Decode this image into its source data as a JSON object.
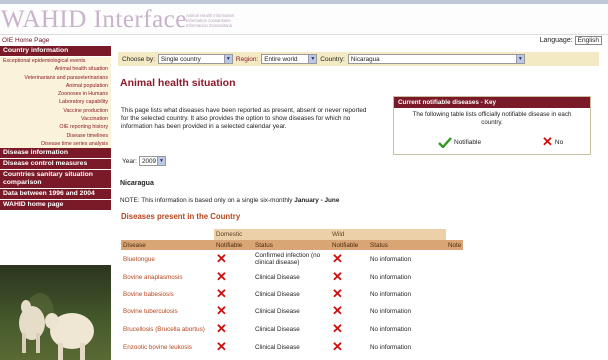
{
  "header": {
    "logo_text": "WAHID Interface",
    "logo_sub_lines": [
      "Animal Health Information",
      "Information zoosanitaire",
      "Información Zoosanitaria"
    ],
    "home_link": "OIE Home Page",
    "language_label": "Language:",
    "language_value": "English"
  },
  "sidebar": {
    "country_info_header": "Country information",
    "country_items": [
      "Exceptional epidemiological events",
      "Animal health situation",
      "Veterinarians and paraveterinarians",
      "Animal population",
      "Zoonoses in Humans",
      "Laboratory capability",
      "Vaccine production",
      "Vaccination",
      "OIE reporting history",
      "Disease timelines",
      "Disease time series analysis"
    ],
    "headers": [
      "Disease information",
      "Disease control measures",
      "Countries sanitary situation comparison",
      "Data between 1996 and 2004",
      "WAHID home page"
    ]
  },
  "filter": {
    "choose_by_label": "Choose by:",
    "choose_by_value": "Single country",
    "region_label": "Region:",
    "region_value": "Entire world",
    "country_label": "Country:",
    "country_value": "Nicaragua"
  },
  "main": {
    "title": "Animal health situation",
    "intro": "This page lists what diseases have been reported as present, absent or never reported for the selected country. It also provides the option to show diseases for which no information has been provided in a selected calendar year.",
    "year_label": "Year:",
    "year_value": "2009",
    "country_name": "Nicaragua",
    "note_prefix": "NOTE: This information is based only on a single six-monthly ",
    "note_period": "January - June",
    "section_title": "Diseases present in the Country"
  },
  "key": {
    "header": "Current notifiable diseases - Key",
    "text": "The following table lists officially notifiable disease in each country.",
    "notifiable_label": "Notifiable",
    "no_label": "No"
  },
  "table": {
    "group_domestic": "Domestic",
    "group_wild": "Wild",
    "columns": [
      "Disease",
      "Notifiable",
      "Status",
      "Notifiable",
      "Status",
      "Note"
    ],
    "rows": [
      {
        "disease": "Bluetongue",
        "dom_status": "Confirmed infection (no clinical disease)",
        "wild_status": "No information"
      },
      {
        "disease": "Bovine anaplasmosis",
        "dom_status": "Clinical Disease",
        "wild_status": "No information"
      },
      {
        "disease": "Bovine babesiosis",
        "dom_status": "Clinical Disease",
        "wild_status": "No information"
      },
      {
        "disease": "Bovine tuberculosis",
        "dom_status": "Clinical Disease",
        "wild_status": "No information"
      },
      {
        "disease": "Brucellosis (Brucella abortus)",
        "dom_status": "Clinical Disease",
        "wild_status": "No information"
      },
      {
        "disease": "Enzootic bovine leukosis",
        "dom_status": "Clinical Disease",
        "wild_status": "No information"
      }
    ]
  },
  "colors": {
    "brand_maroon": "#7a1a28",
    "accent_orange": "#b5461e",
    "cross_red": "#cc1010",
    "check_green": "#2e9a1a"
  },
  "icons": {
    "cross": "cross-icon",
    "check": "checkmark-icon",
    "dropdown": "chevron-down-icon"
  }
}
